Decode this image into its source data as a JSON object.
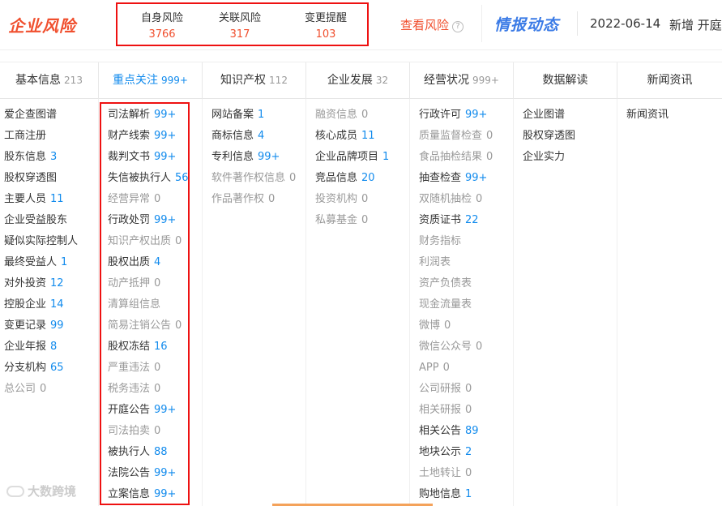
{
  "header": {
    "brand": "企业风险",
    "risks": [
      {
        "label": "自身风险",
        "value": "3766"
      },
      {
        "label": "关联风险",
        "value": "317"
      },
      {
        "label": "变更提醒",
        "value": "103"
      }
    ],
    "view_risk": "查看风险",
    "help_icon": "?",
    "intel": "情报动态",
    "date": "2022-06-14",
    "new_added": "新增 开庭"
  },
  "tabs": [
    {
      "label": "基本信息",
      "count": "213"
    },
    {
      "label": "重点关注",
      "count": "999+"
    },
    {
      "label": "知识产权",
      "count": "112"
    },
    {
      "label": "企业发展",
      "count": "32"
    },
    {
      "label": "经营状况",
      "count": "999+"
    },
    {
      "label": "数据解读",
      "count": ""
    },
    {
      "label": "新闻资讯",
      "count": ""
    }
  ],
  "columns": [
    [
      {
        "label": "爱企查图谱",
        "count": "",
        "dim": false
      },
      {
        "label": "工商注册",
        "count": "",
        "dim": false
      },
      {
        "label": "股东信息",
        "count": "3",
        "dim": false
      },
      {
        "label": "股权穿透图",
        "count": "",
        "dim": false
      },
      {
        "label": "主要人员",
        "count": "11",
        "dim": false
      },
      {
        "label": "企业受益股东",
        "count": "",
        "dim": false
      },
      {
        "label": "疑似实际控制人",
        "count": "",
        "dim": false
      },
      {
        "label": "最终受益人",
        "count": "1",
        "dim": false
      },
      {
        "label": "对外投资",
        "count": "12",
        "dim": false
      },
      {
        "label": "控股企业",
        "count": "14",
        "dim": false
      },
      {
        "label": "变更记录",
        "count": "99",
        "dim": false
      },
      {
        "label": "企业年报",
        "count": "8",
        "dim": false
      },
      {
        "label": "分支机构",
        "count": "65",
        "dim": false
      },
      {
        "label": "总公司",
        "count": "0",
        "dim": true
      }
    ],
    [
      {
        "label": "司法解析",
        "count": "99+",
        "dim": false
      },
      {
        "label": "财产线索",
        "count": "99+",
        "dim": false
      },
      {
        "label": "裁判文书",
        "count": "99+",
        "dim": false
      },
      {
        "label": "失信被执行人",
        "count": "56",
        "dim": false
      },
      {
        "label": "经营异常",
        "count": "0",
        "dim": true
      },
      {
        "label": "行政处罚",
        "count": "99+",
        "dim": false
      },
      {
        "label": "知识产权出质",
        "count": "0",
        "dim": true
      },
      {
        "label": "股权出质",
        "count": "4",
        "dim": false
      },
      {
        "label": "动产抵押",
        "count": "0",
        "dim": true
      },
      {
        "label": "清算组信息",
        "count": "",
        "dim": true
      },
      {
        "label": "简易注销公告",
        "count": "0",
        "dim": true
      },
      {
        "label": "股权冻结",
        "count": "16",
        "dim": false
      },
      {
        "label": "严重违法",
        "count": "0",
        "dim": true
      },
      {
        "label": "税务违法",
        "count": "0",
        "dim": true
      },
      {
        "label": "开庭公告",
        "count": "99+",
        "dim": false
      },
      {
        "label": "司法拍卖",
        "count": "0",
        "dim": true
      },
      {
        "label": "被执行人",
        "count": "88",
        "dim": false
      },
      {
        "label": "法院公告",
        "count": "99+",
        "dim": false
      },
      {
        "label": "立案信息",
        "count": "99+",
        "dim": false
      }
    ],
    [
      {
        "label": "网站备案",
        "count": "1",
        "dim": false
      },
      {
        "label": "商标信息",
        "count": "4",
        "dim": false
      },
      {
        "label": "专利信息",
        "count": "99+",
        "dim": false
      },
      {
        "label": "软件著作权信息",
        "count": "0",
        "dim": true
      },
      {
        "label": "作品著作权",
        "count": "0",
        "dim": true
      }
    ],
    [
      {
        "label": "融资信息",
        "count": "0",
        "dim": true
      },
      {
        "label": "核心成员",
        "count": "11",
        "dim": false
      },
      {
        "label": "企业品牌项目",
        "count": "1",
        "dim": false
      },
      {
        "label": "竞品信息",
        "count": "20",
        "dim": false
      },
      {
        "label": "投资机构",
        "count": "0",
        "dim": true
      },
      {
        "label": "私募基金",
        "count": "0",
        "dim": true
      }
    ],
    [
      {
        "label": "行政许可",
        "count": "99+",
        "dim": false
      },
      {
        "label": "质量监督检查",
        "count": "0",
        "dim": true
      },
      {
        "label": "食品抽检结果",
        "count": "0",
        "dim": true
      },
      {
        "label": "抽查检查",
        "count": "99+",
        "dim": false
      },
      {
        "label": "双随机抽检",
        "count": "0",
        "dim": true
      },
      {
        "label": "资质证书",
        "count": "22",
        "dim": false
      },
      {
        "label": "财务指标",
        "count": "",
        "dim": true
      },
      {
        "label": "利润表",
        "count": "",
        "dim": true
      },
      {
        "label": "资产负债表",
        "count": "",
        "dim": true
      },
      {
        "label": "现金流量表",
        "count": "",
        "dim": true
      },
      {
        "label": "微博",
        "count": "0",
        "dim": true
      },
      {
        "label": "微信公众号",
        "count": "0",
        "dim": true
      },
      {
        "label": "APP",
        "count": "0",
        "dim": true
      },
      {
        "label": "公司研报",
        "count": "0",
        "dim": true
      },
      {
        "label": "相关研报",
        "count": "0",
        "dim": true
      },
      {
        "label": "相关公告",
        "count": "89",
        "dim": false
      },
      {
        "label": "地块公示",
        "count": "2",
        "dim": false
      },
      {
        "label": "土地转让",
        "count": "0",
        "dim": true
      },
      {
        "label": "购地信息",
        "count": "1",
        "dim": false
      }
    ],
    [
      {
        "label": "企业图谱",
        "count": "",
        "dim": false
      },
      {
        "label": "股权穿透图",
        "count": "",
        "dim": false
      },
      {
        "label": "企业实力",
        "count": "",
        "dim": false
      }
    ],
    [
      {
        "label": "新闻资讯",
        "count": "",
        "dim": false
      }
    ]
  ],
  "watermark": "大数跨境",
  "colors": {
    "accent_red": "#f04f2e",
    "link_blue": "#128bed",
    "intel_blue": "#3b7be6",
    "highlight_box": "#e11"
  }
}
